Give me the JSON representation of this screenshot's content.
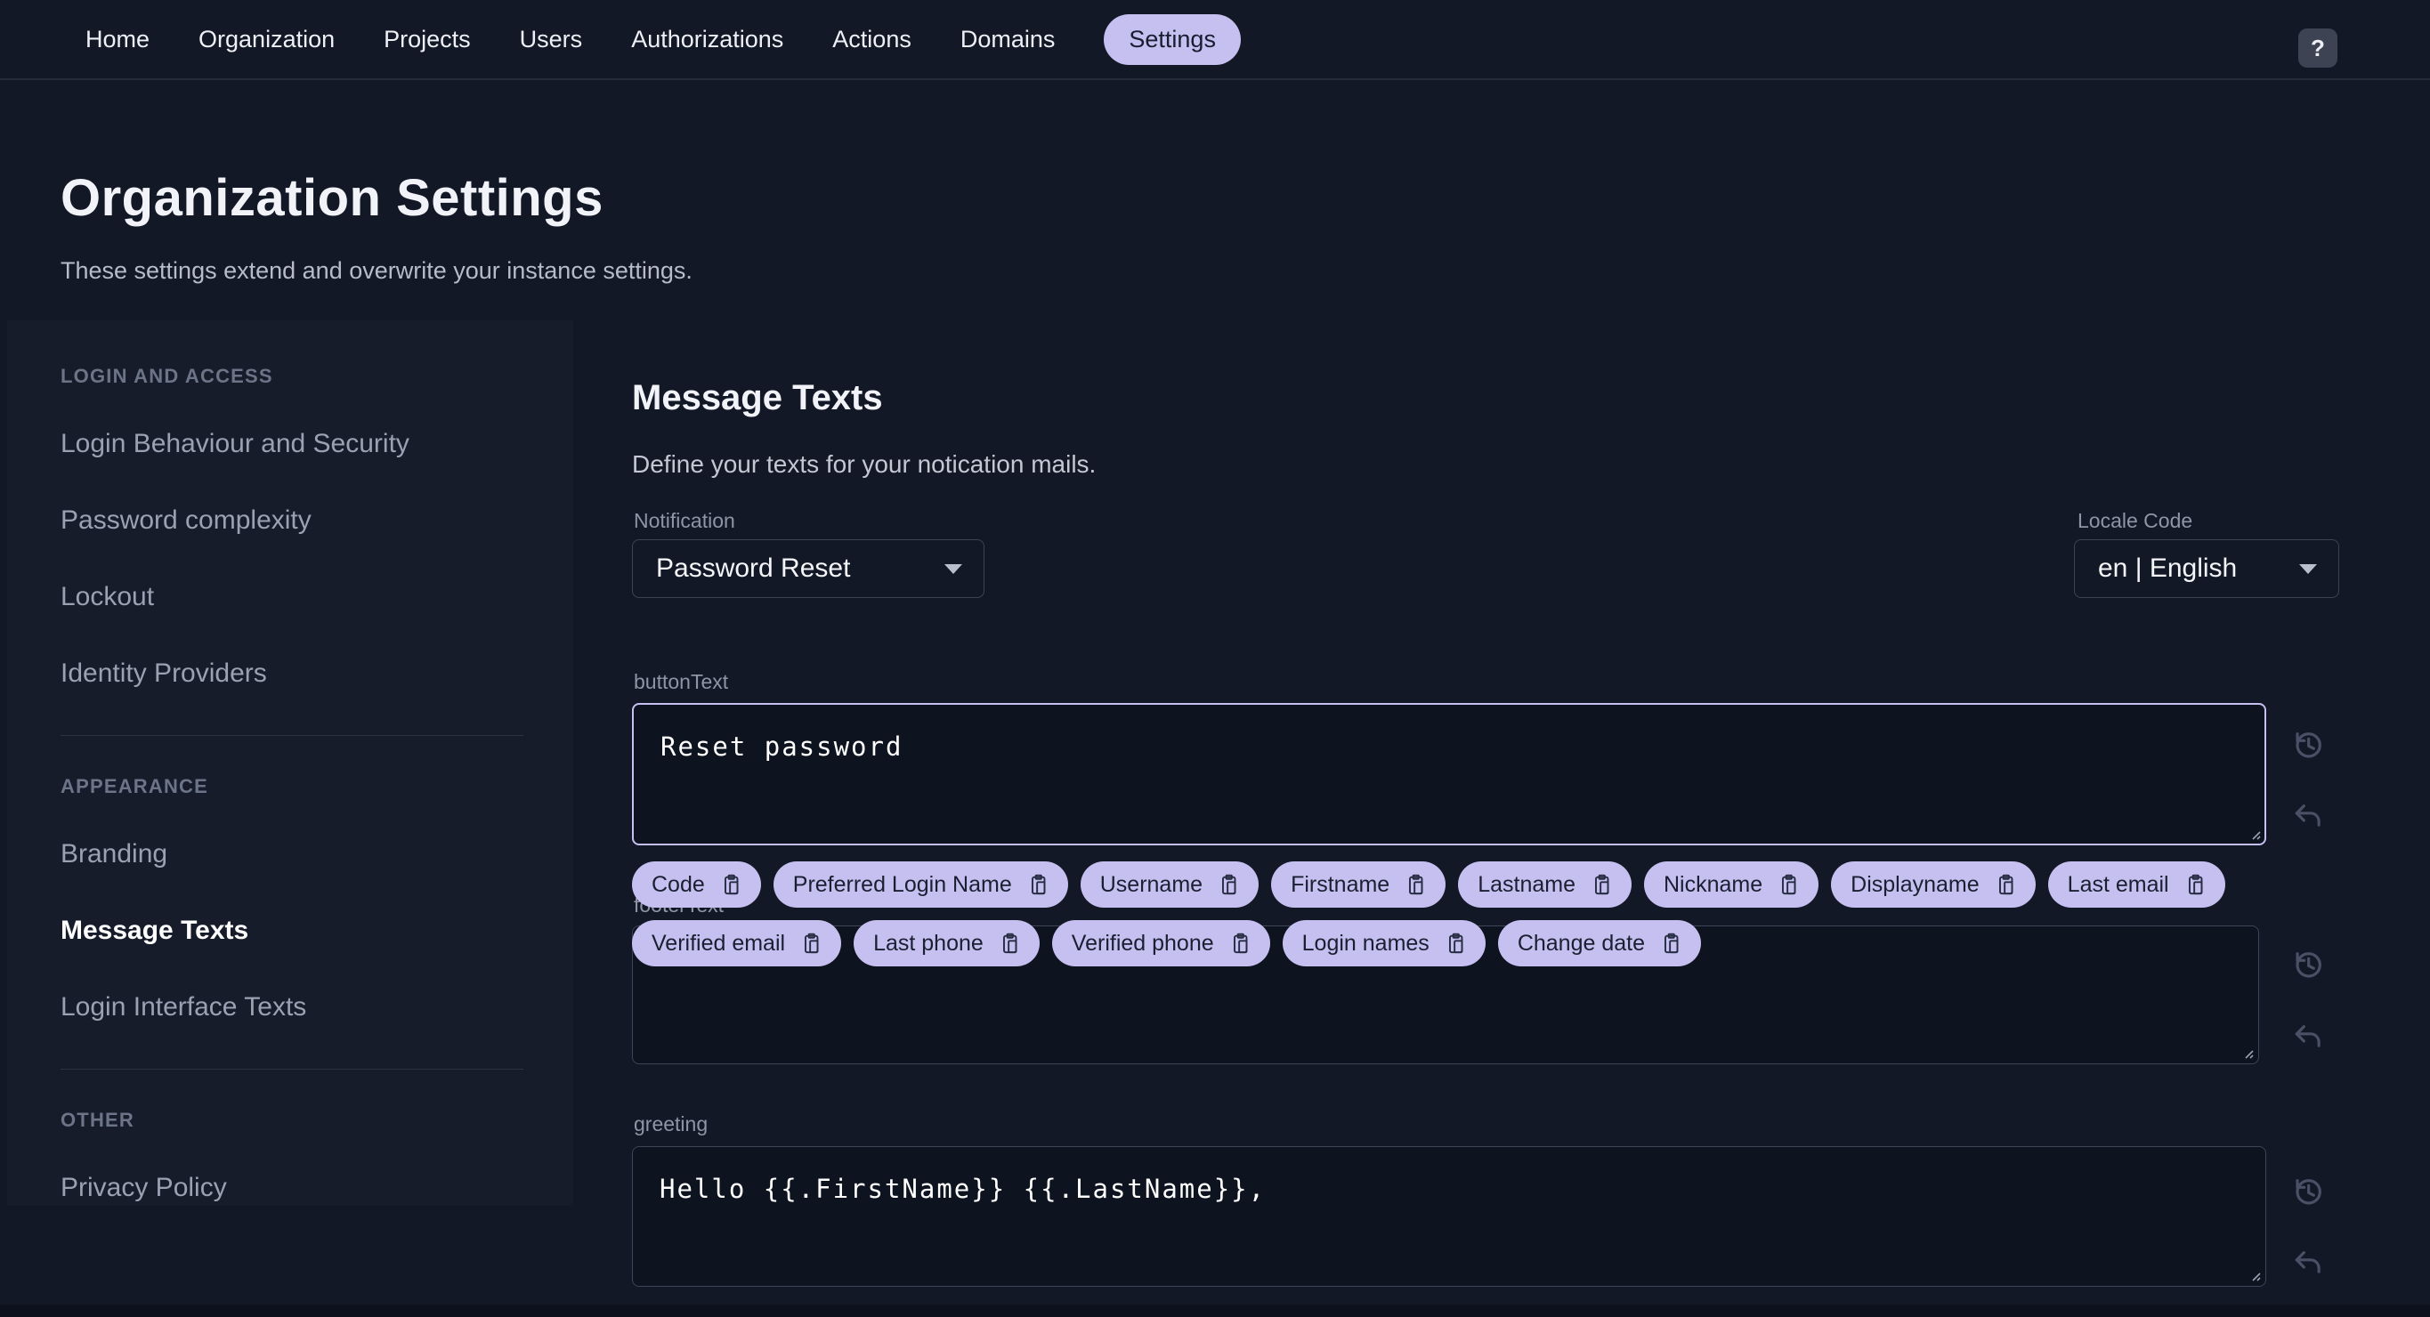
{
  "nav": {
    "items": [
      {
        "label": "Home",
        "active": false
      },
      {
        "label": "Organization",
        "active": false
      },
      {
        "label": "Projects",
        "active": false
      },
      {
        "label": "Users",
        "active": false
      },
      {
        "label": "Authorizations",
        "active": false
      },
      {
        "label": "Actions",
        "active": false
      },
      {
        "label": "Domains",
        "active": false
      },
      {
        "label": "Settings",
        "active": true
      }
    ],
    "help_label": "?"
  },
  "page": {
    "title": "Organization Settings",
    "subtitle": "These settings extend and overwrite your instance settings."
  },
  "sidebar": {
    "sections": [
      {
        "header": "LOGIN AND ACCESS",
        "items": [
          {
            "label": "Login Behaviour and Security",
            "active": false
          },
          {
            "label": "Password complexity",
            "active": false
          },
          {
            "label": "Lockout",
            "active": false
          },
          {
            "label": "Identity Providers",
            "active": false
          }
        ]
      },
      {
        "header": "APPEARANCE",
        "items": [
          {
            "label": "Branding",
            "active": false
          },
          {
            "label": "Message Texts",
            "active": true
          },
          {
            "label": "Login Interface Texts",
            "active": false
          }
        ]
      },
      {
        "header": "OTHER",
        "items": [
          {
            "label": "Privacy Policy",
            "active": false
          }
        ]
      }
    ]
  },
  "main": {
    "heading": "Message Texts",
    "description": "Define your texts for your notication mails.",
    "notification": {
      "label": "Notification",
      "value": "Password Reset"
    },
    "locale": {
      "label": "Locale Code",
      "value": "en | English"
    },
    "fields": {
      "button_text": {
        "label": "buttonText",
        "value": "Reset password"
      },
      "footer_text": {
        "label": "footerText",
        "value": ""
      },
      "greeting": {
        "label": "greeting",
        "value": "Hello {{.FirstName}} {{.LastName}},"
      }
    },
    "chips": {
      "row1": [
        "Code",
        "Preferred Login Name",
        "Username",
        "Firstname",
        "Lastname",
        "Nickname",
        "Displayname",
        "Last email"
      ],
      "row2": [
        "Verified email",
        "Last phone",
        "Verified phone",
        "Login names",
        "Change date"
      ]
    }
  },
  "icons": {
    "help": "question-mark",
    "chip_action": "clipboard-icon",
    "field_actions": [
      "history-icon",
      "undo-icon"
    ],
    "dropdown": "caret-down-icon"
  },
  "colors": {
    "accent": "#c6c0f1",
    "background": "#131826",
    "panel": "#171c2b",
    "textarea_bg": "#0e1320",
    "border_muted": "#3e4556",
    "text_primary": "#f1f3f8",
    "text_muted": "#8d95a6",
    "chip_text": "#1a1f31"
  }
}
